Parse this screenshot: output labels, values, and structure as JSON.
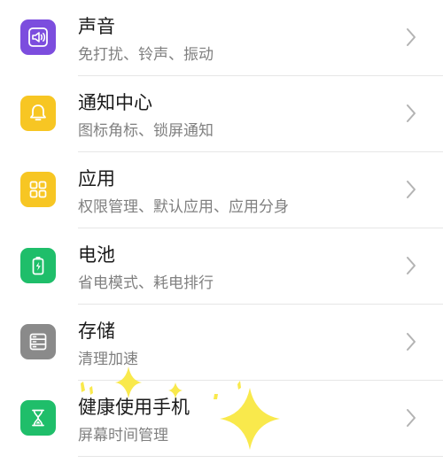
{
  "settings": {
    "items": [
      {
        "title": "声音",
        "subtitle": "免打扰、铃声、振动",
        "icon": "sound-icon",
        "color": "#7c4dde"
      },
      {
        "title": "通知中心",
        "subtitle": "图标角标、锁屏通知",
        "icon": "bell-icon",
        "color": "#f7c623"
      },
      {
        "title": "应用",
        "subtitle": "权限管理、默认应用、应用分身",
        "icon": "apps-grid-icon",
        "color": "#f7c623"
      },
      {
        "title": "电池",
        "subtitle": "省电模式、耗电排行",
        "icon": "battery-icon",
        "color": "#1fbe6a"
      },
      {
        "title": "存储",
        "subtitle": "清理加速",
        "icon": "storage-icon",
        "color": "#8a8a8a"
      },
      {
        "title": "健康使用手机",
        "subtitle": "屏幕时间管理",
        "icon": "hourglass-icon",
        "color": "#1fbe6a"
      }
    ]
  },
  "decoration": {
    "sparkle_color": "#f9e94c"
  }
}
